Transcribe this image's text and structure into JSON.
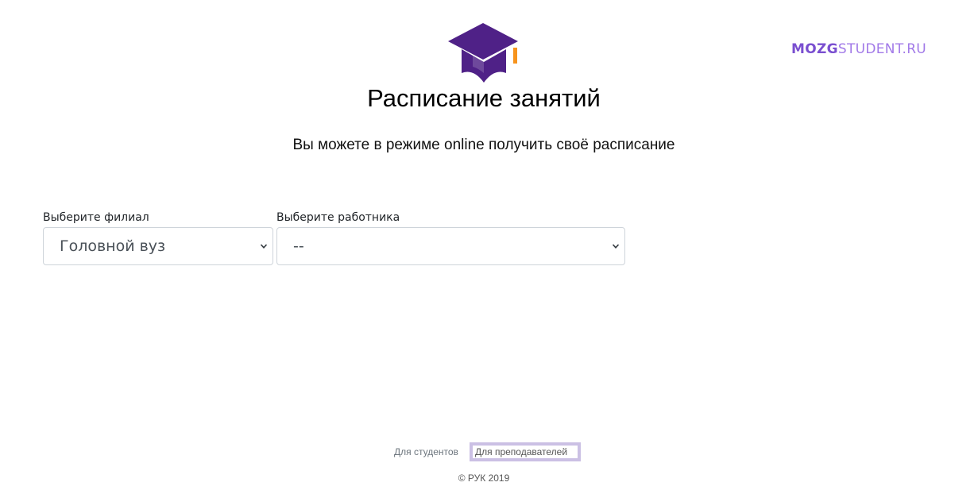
{
  "header": {
    "logo_icon": "graduation-cap-icon",
    "brand_bold": "MOZG",
    "brand_light": "STUDENT.RU",
    "title": "Расписание занятий",
    "subtitle": "Вы можете в режиме online получить своё расписание"
  },
  "filters": {
    "branch": {
      "label": "Выберите филиал",
      "selected": "Головной вуз"
    },
    "employee": {
      "label": "Выберите работника",
      "selected": "--"
    }
  },
  "footer": {
    "links": [
      {
        "label": "Для студентов",
        "active": false
      },
      {
        "label": "Для преподавателей",
        "active": true
      }
    ],
    "copyright": "© РУК 2019"
  },
  "colors": {
    "logo_purple": "#4f2187",
    "logo_orange": "#f7941d",
    "brand_bold": "#7a4fd0",
    "brand_light": "#a27ae8",
    "active_outline": "#cbc0e4"
  }
}
